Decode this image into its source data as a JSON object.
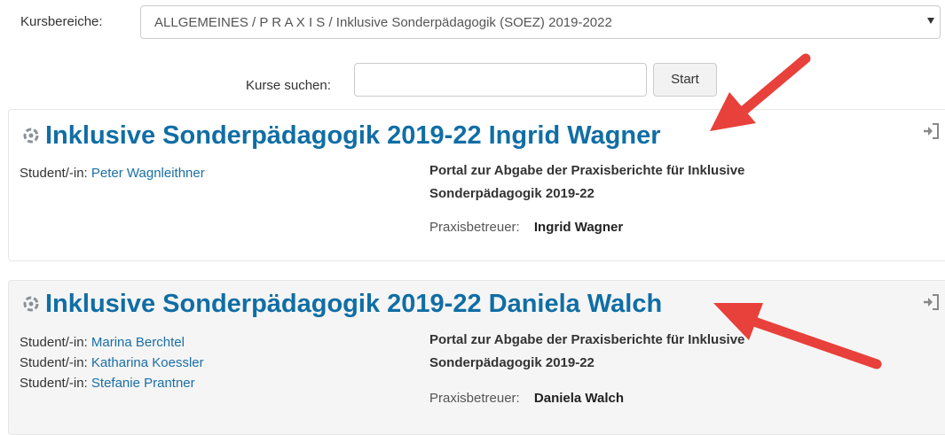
{
  "filter": {
    "category_label": "Kursbereiche:",
    "category_value": "ALLGEMEINES / P R A X I S / Inklusive Sonderpädagogik (SOEZ) 2019-2022"
  },
  "search": {
    "label": "Kurse suchen:",
    "value": "",
    "button_label": "Start"
  },
  "courses": [
    {
      "title": "Inklusive Sonderpädagogik 2019-22 Ingrid Wagner",
      "students_label": "Student/-in:",
      "students": [
        "Peter Wagnleithner"
      ],
      "summary": "Portal zur Abgabe der Praxisberichte für Inklusive Sonderpädagogik 2019-22",
      "teacher_label": "Praxisbetreuer:",
      "teacher": "Ingrid Wagner"
    },
    {
      "title": "Inklusive Sonderpädagogik 2019-22 Daniela Walch",
      "students_label": "Student/-in:",
      "students": [
        "Marina Berchtel",
        "Katharina Koessler",
        "Stefanie Prantner"
      ],
      "summary": "Portal zur Abgabe der Praxisberichte für Inklusive Sonderpädagogik 2019-22",
      "teacher_label": "Praxisbetreuer:",
      "teacher": "Daniela Walch"
    }
  ],
  "icons": {
    "course": "course-icon",
    "enrol": "enrol-self-icon",
    "annotation": "red-arrow"
  },
  "colors": {
    "link": "#106ea5",
    "annotation_arrow": "#e8403a"
  }
}
